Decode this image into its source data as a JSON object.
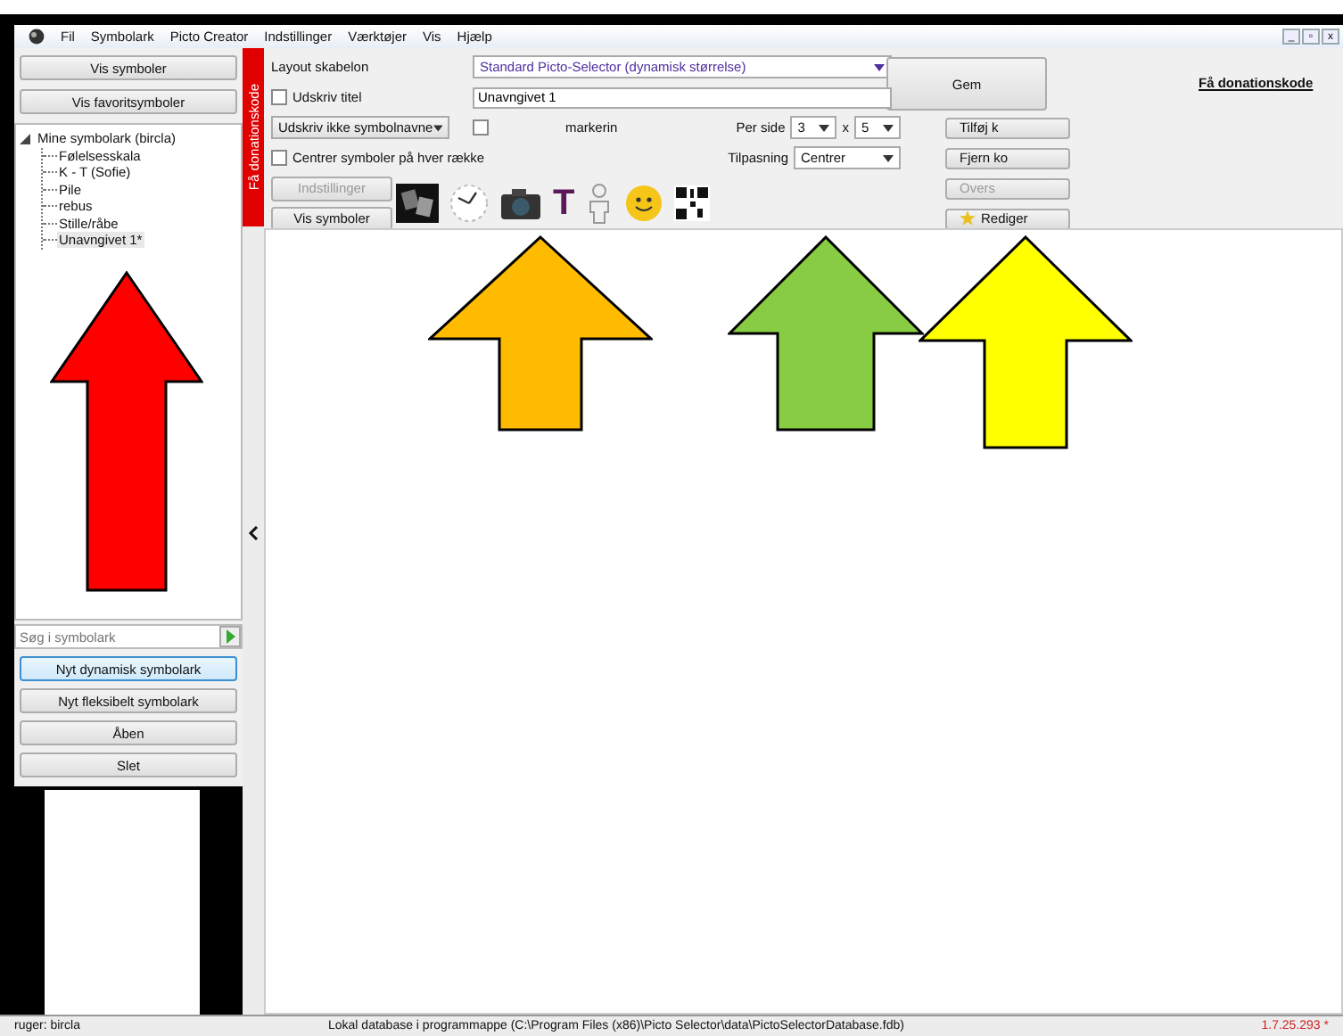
{
  "menu": [
    "Fil",
    "Symbolark",
    "Picto Creator",
    "Indstillinger",
    "Værktøjer",
    "Vis",
    "Hjælp"
  ],
  "window_controls": [
    "_",
    "▫",
    "x"
  ],
  "sidebar": {
    "buttons_top": [
      "Vis symboler",
      "Vis favoritsymboler"
    ],
    "tree": [
      {
        "label": "Mine symbolark (bircla)",
        "expanded": true,
        "selected": false,
        "children": [
          {
            "label": "Følelsesskala",
            "selected": false
          },
          {
            "label": "K - T (Sofie)",
            "selected": false
          },
          {
            "label": "Pile",
            "selected": false
          },
          {
            "label": "rebus",
            "selected": false
          },
          {
            "label": "Stille/råbe",
            "selected": false
          },
          {
            "label": "Unavngivet 1*",
            "selected": true
          }
        ]
      }
    ],
    "search": {
      "placeholder": "Søg i symbolark"
    },
    "buttons_bottom": [
      {
        "label": "Nyt dynamisk symbolark",
        "selected": true
      },
      {
        "label": "Nyt fleksibelt symbolark",
        "selected": false
      },
      {
        "label": "Åben",
        "selected": false
      },
      {
        "label": "Slet",
        "selected": false
      }
    ]
  },
  "donation_strip": "Få donationskode",
  "toolbar": {
    "layout_label": "Layout skabelon",
    "layout_value": "Standard Picto-Selector (dynamisk størrelse)",
    "title_checkbox": {
      "label": "Udskriv titel",
      "checked": false
    },
    "title_value": "Unavngivet 1",
    "names_dropdown": "Udskriv ikke symbolnavne",
    "mark_checkbox": {
      "label": "markerin",
      "checked": false
    },
    "center_checkbox": {
      "label": "Centrer symboler på hver række",
      "checked": false
    },
    "per_side_label": "Per side",
    "rows": "3",
    "times": "x",
    "cols": "5",
    "fit_label": "Tilpasning",
    "fit_value": "Centrer",
    "settings_button": {
      "label": "Indstillinger",
      "disabled": true
    },
    "show_button": {
      "label": "Vis symboler",
      "disabled": false
    },
    "symbols": [
      {
        "kind": "photo"
      },
      {
        "kind": "clock"
      },
      {
        "kind": "camera"
      },
      {
        "kind": "letter",
        "label": "T"
      },
      {
        "kind": "person"
      },
      {
        "kind": "smiley"
      },
      {
        "kind": "qr"
      }
    ],
    "save_button": {
      "label": "Gem",
      "disabled": false
    },
    "side_buttons": [
      {
        "label": "Tilføj k",
        "disabled": false
      },
      {
        "label": "Fjern ko",
        "disabled": false
      },
      {
        "label": "Overs",
        "disabled": true
      },
      {
        "label": "Rediger",
        "disabled": false
      }
    ],
    "donation_link": "Få donationskode"
  },
  "annotations": [
    {
      "color": "#ff0000"
    },
    {
      "color": "#ffbb00"
    },
    {
      "color": "#88cc44"
    },
    {
      "color": "#ffff00"
    }
  ],
  "status_bar": {
    "user": "ruger: bircla",
    "database": "Lokal database i programmappe (C:\\Program Files (x86)\\Picto Selector\\data\\PictoSelectorDatabase.fdb)",
    "version": "1.7.25.293 *"
  }
}
